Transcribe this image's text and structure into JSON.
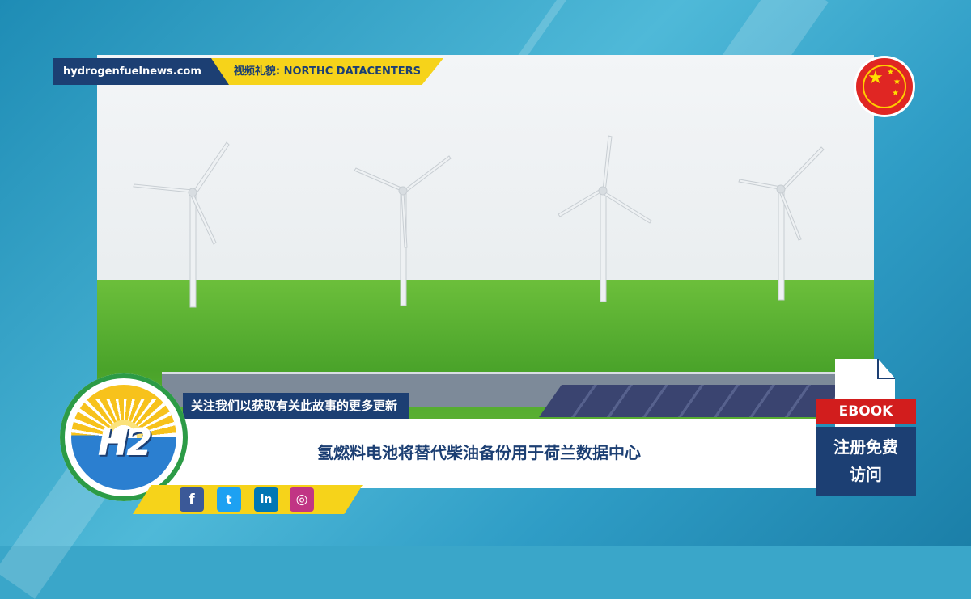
{
  "site": "hydrogenfuelnews.com",
  "video_credit": "视频礼貌: NORTHC DATACENTERS",
  "ticker_text": "关注我们以获取有关此故事的更多更新",
  "headline": "氢燃料电池将替代柴油备份用于荷兰数据中心",
  "ebook": {
    "label": "EBOOK",
    "cta_line1": "注册免费",
    "cta_line2": "访问"
  },
  "logo_text": "H2",
  "social_icons": [
    "facebook-icon",
    "twitter-icon",
    "linkedin-icon",
    "instagram-icon"
  ],
  "social_glyphs": [
    "f",
    "t",
    "in",
    "◎"
  ],
  "colors": {
    "navy": "#1c3f73",
    "yellow": "#f6d31a",
    "red": "#d21d1d",
    "facebook": "#3b5998",
    "twitter": "#1da1f2",
    "linkedin": "#0077b5",
    "instagram": "#c13584"
  }
}
